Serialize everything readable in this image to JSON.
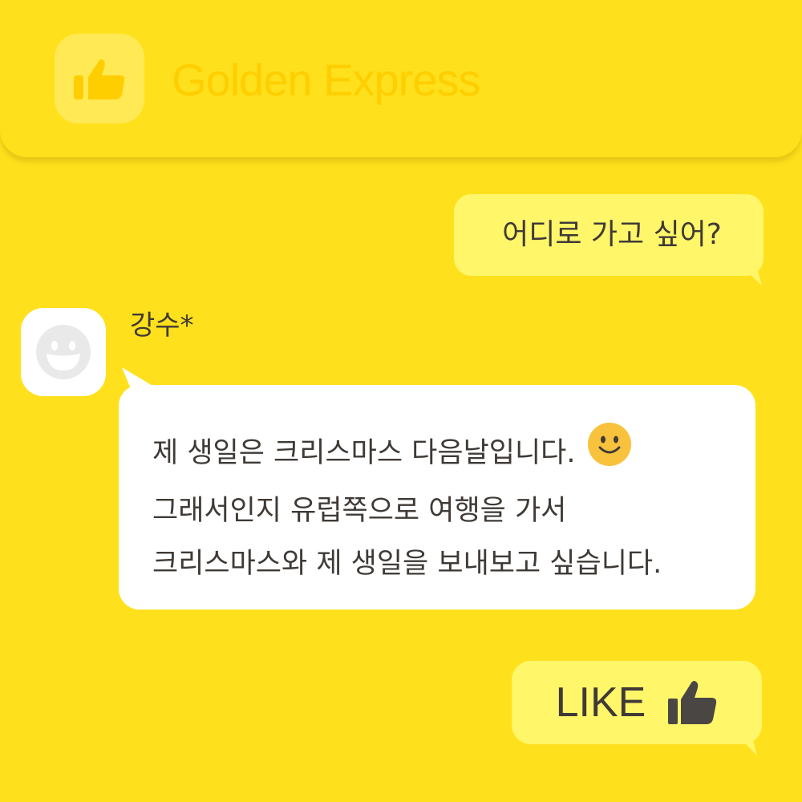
{
  "header": {
    "app_name": "Golden Express",
    "logo_icon": "thumbs-up-icon"
  },
  "messages": {
    "sent_1": {
      "text": "어디로 가고 싶어?"
    },
    "received": {
      "sender": "강수*",
      "avatar_icon": "smiling-face-avatar-icon",
      "lines": [
        "제 생일은 크리스마스 다음날입니다.",
        "그래서인지 유럽쪽으로 여행을 가서",
        "크리스마스와 제 생일을 보내보고 싶습니다."
      ],
      "emoji": "smiley-emoji-icon"
    },
    "sent_2": {
      "text": "LIKE",
      "icon": "thumbs-up-icon"
    }
  },
  "colors": {
    "background": "#FFE01C",
    "sent_bubble": "#FFF66A",
    "received_bubble": "#FFFFFF",
    "text": "#3f3a36",
    "brand_text": "#FFCE00"
  }
}
